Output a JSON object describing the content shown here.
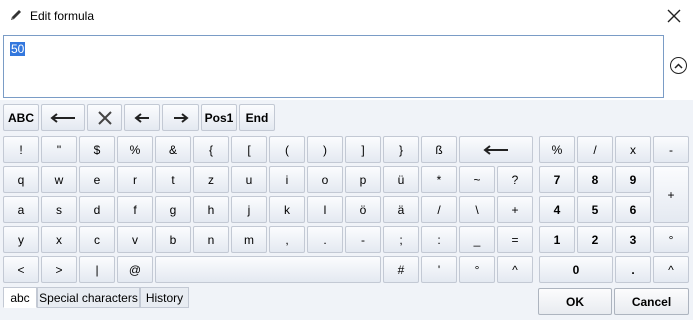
{
  "window": {
    "title": "Edit formula"
  },
  "formula": {
    "value": "50"
  },
  "toolbar": {
    "abc_label": "ABC",
    "pos1_label": "Pos1",
    "end_label": "End"
  },
  "keys": {
    "r0": [
      "!",
      "\"",
      "$",
      "%",
      "&",
      "{",
      "[",
      "(",
      ")",
      "]",
      "}",
      "ß"
    ],
    "r1": [
      "q",
      "w",
      "e",
      "r",
      "t",
      "z",
      "u",
      "i",
      "o",
      "p",
      "ü",
      "*",
      "~",
      "?"
    ],
    "r2": [
      "a",
      "s",
      "d",
      "f",
      "g",
      "h",
      "j",
      "k",
      "l",
      "ö",
      "ä",
      "/",
      "\\",
      "+"
    ],
    "r3": [
      "y",
      "x",
      "c",
      "v",
      "b",
      "n",
      "m",
      ",",
      ".",
      "-",
      ";",
      ":",
      "_",
      "="
    ],
    "r4a": [
      "<",
      ">",
      "|",
      "@"
    ],
    "r4b": [
      "#",
      "'",
      "°",
      "^"
    ]
  },
  "numpad": {
    "r0": [
      "%",
      "/",
      "x",
      "-"
    ],
    "r1": [
      "7",
      "8",
      "9"
    ],
    "r2": [
      "4",
      "5",
      "6"
    ],
    "r3": [
      "1",
      "2",
      "3",
      "°"
    ],
    "r4": [
      "0",
      ".",
      "^"
    ],
    "plus": "+"
  },
  "tabs": [
    "abc",
    "Special characters",
    "History"
  ],
  "buttons": {
    "ok": "OK",
    "cancel": "Cancel"
  }
}
